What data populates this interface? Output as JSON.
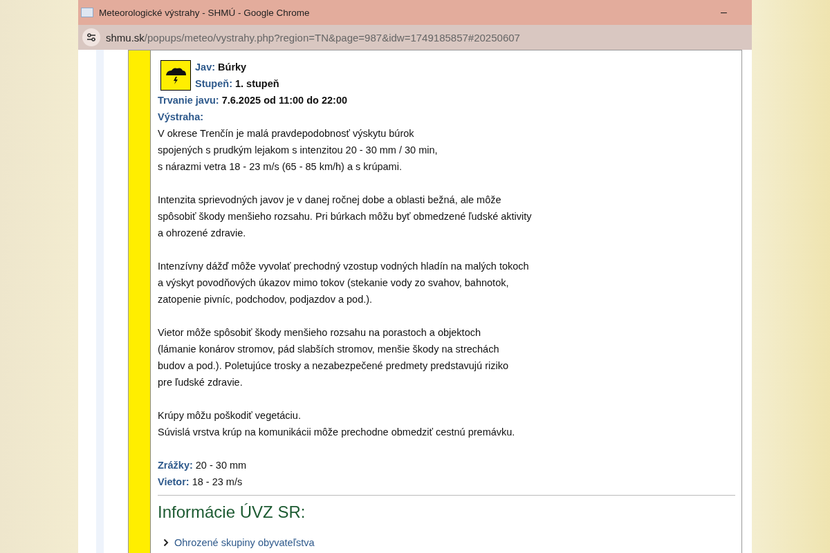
{
  "window": {
    "title": "Meteorologické výstrahy - SHMÚ - Google Chrome",
    "minimize": "–"
  },
  "address_bar": {
    "domain": "shmu.sk",
    "path": "/popups/meteo/vystrahy.php?region=TN&page=987&idw=1749185857#20250607"
  },
  "warning": {
    "phenomenon": {
      "label": "Jav:",
      "value": "Búrky"
    },
    "degree": {
      "label": "Stupeň:",
      "value": "1. stupeň"
    },
    "duration": {
      "label": "Trvanie javu:",
      "value": "7.6.2025 od 11:00 do 22:00"
    },
    "warning_label": "Výstraha:",
    "paragraphs": [
      [
        "V okrese Trenčín je malá pravdepodobnosť výskytu búrok",
        "spojených s prudkým lejakom s intenzitou 20 - 30 mm / 30 min,",
        "s nárazmi vetra 18 - 23 m/s (65 - 85 km/h) a s krúpami."
      ],
      [
        "Intenzita sprievodných javov je v danej ročnej dobe a oblasti bežná, ale môže",
        "spôsobiť škody menšieho rozsahu. Pri búrkach môžu byť obmedzené ľudské aktivity",
        "a ohrozené zdravie."
      ],
      [
        "Intenzívny dážď môže vyvolať prechodný vzostup vodných hladín na malých tokoch",
        "a výskyt povodňových úkazov mimo tokov (stekanie vody zo svahov, bahnotok,",
        "zatopenie pivníc, podchodov, podjazdov a pod.)."
      ],
      [
        "Vietor môže spôsobiť škody menšieho rozsahu na porastoch a objektoch",
        "(lámanie konárov stromov, pád slabších stromov, menšie škody na strechách",
        "budov a pod.). Poletujúce trosky a nezabezpečené predmety predstavujú riziko",
        "pre ľudské zdravie."
      ],
      [
        "Krúpy môžu poškodiť vegetáciu.",
        "Súvislá vrstva krúp na komunikácii môže prechodne obmedziť cestnú premávku."
      ]
    ],
    "details": [
      {
        "label": "Zrážky:",
        "value": "20 - 30 mm"
      },
      {
        "label": "Vietor:",
        "value": "18 - 23 m/s"
      }
    ],
    "info_heading": "Informácie ÚVZ SR:",
    "info_links": [
      {
        "label": "Ohrozené skupiny obyvateľstva",
        "expanded": false
      }
    ]
  }
}
